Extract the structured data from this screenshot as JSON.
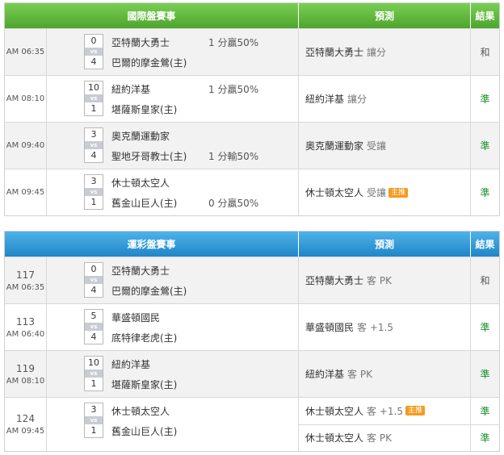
{
  "sections": [
    {
      "header": {
        "match": "國際盤賽事",
        "prediction": "預測",
        "result": "結果"
      },
      "rows": [
        {
          "num": "",
          "time": "AM 06:35",
          "score1": "0",
          "score2": "4",
          "vs": "vs",
          "team1": "亞特蘭大勇士",
          "team2": "巴爾的摩金鶯(主)",
          "hc1": "1 分贏50%",
          "hc2": "",
          "predictions": [
            {
              "team": "亞特蘭大勇士",
              "pick": "讓分",
              "tag": ""
            }
          ],
          "results": [
            "和"
          ]
        },
        {
          "num": "",
          "time": "AM 08:10",
          "score1": "10",
          "score2": "1",
          "vs": "vs",
          "team1": "紐約洋基",
          "team2": "堪薩斯皇家(主)",
          "hc1": "1 分贏50%",
          "hc2": "",
          "predictions": [
            {
              "team": "紐約洋基",
              "pick": "讓分",
              "tag": ""
            }
          ],
          "results": [
            "準"
          ]
        },
        {
          "num": "",
          "time": "AM 09:40",
          "score1": "3",
          "score2": "4",
          "vs": "vs",
          "team1": "奧克蘭運動家",
          "team2": "聖地牙哥教士(主)",
          "hc1": "",
          "hc2": "1 分輸50%",
          "predictions": [
            {
              "team": "奧克蘭運動家",
              "pick": "受讓",
              "tag": ""
            }
          ],
          "results": [
            "準"
          ]
        },
        {
          "num": "",
          "time": "AM 09:45",
          "score1": "3",
          "score2": "1",
          "vs": "vs",
          "team1": "休士頓太空人",
          "team2": "舊金山巨人(主)",
          "hc1": "",
          "hc2": "0 分贏50%",
          "predictions": [
            {
              "team": "休士頓太空人",
              "pick": "受讓",
              "tag": "主推"
            }
          ],
          "results": [
            "準"
          ]
        }
      ]
    },
    {
      "header": {
        "match": "運彩盤賽事",
        "prediction": "預測",
        "result": "結果"
      },
      "rows": [
        {
          "num": "117",
          "time": "AM 06:35",
          "score1": "0",
          "score2": "4",
          "vs": "vs",
          "team1": "亞特蘭大勇士",
          "team2": "巴爾的摩金鶯(主)",
          "hc1": "",
          "hc2": "",
          "predictions": [
            {
              "team": "亞特蘭大勇士",
              "pick": "客 PK",
              "tag": ""
            }
          ],
          "results": [
            "和"
          ]
        },
        {
          "num": "113",
          "time": "AM 06:40",
          "score1": "5",
          "score2": "4",
          "vs": "vs",
          "team1": "華盛頓國民",
          "team2": "底特律老虎(主)",
          "hc1": "",
          "hc2": "",
          "predictions": [
            {
              "team": "華盛頓國民",
              "pick": "客 +1.5",
              "tag": ""
            }
          ],
          "results": [
            "準"
          ]
        },
        {
          "num": "119",
          "time": "AM 08:10",
          "score1": "10",
          "score2": "1",
          "vs": "vs",
          "team1": "紐約洋基",
          "team2": "堪薩斯皇家(主)",
          "hc1": "",
          "hc2": "",
          "predictions": [
            {
              "team": "紐約洋基",
              "pick": "客 PK",
              "tag": ""
            }
          ],
          "results": [
            "準"
          ]
        },
        {
          "num": "124",
          "time": "AM 09:45",
          "score1": "3",
          "score2": "1",
          "vs": "vs",
          "team1": "休士頓太空人",
          "team2": "舊金山巨人(主)",
          "hc1": "",
          "hc2": "",
          "predictions": [
            {
              "team": "休士頓太空人",
              "pick": "客 +1.5",
              "tag": "主推"
            },
            {
              "team": "休士頓太空人",
              "pick": "客 PK",
              "tag": ""
            }
          ],
          "results": [
            "準",
            "準"
          ]
        }
      ]
    }
  ],
  "colors": {
    "green_header": "#4ea52c",
    "blue_header": "#1f86c8",
    "win": "#1a8f2a",
    "tag": "#f39a1e"
  }
}
